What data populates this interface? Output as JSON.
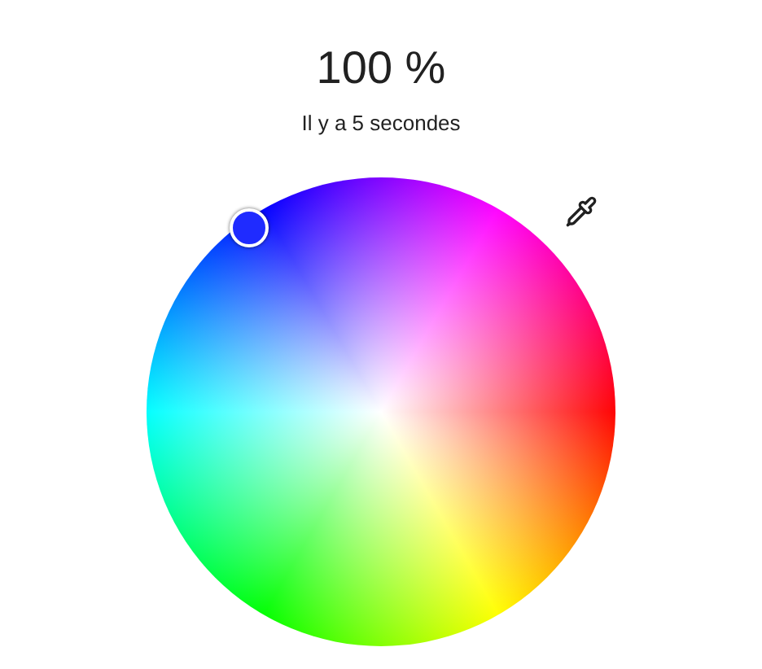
{
  "brightness": "100 %",
  "last_changed": "Il y a 5 secondes"
}
